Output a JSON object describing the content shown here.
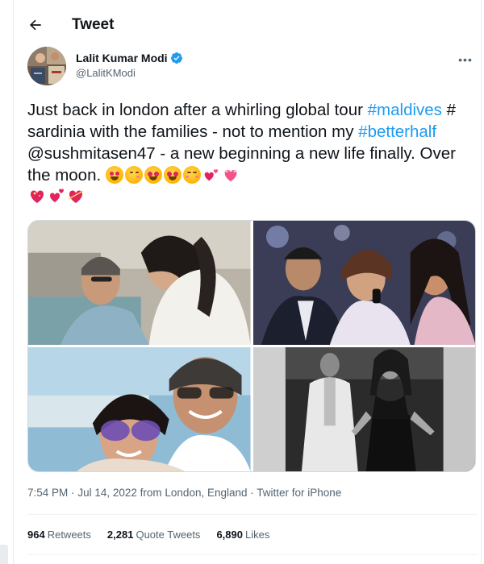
{
  "header": {
    "title": "Tweet"
  },
  "author": {
    "display_name": "Lalit Kumar Modi",
    "handle": "@LalitKModi",
    "verified": true
  },
  "tweet": {
    "segments": [
      {
        "text": "Just back in london after a whirling global tour ",
        "type": "text"
      },
      {
        "text": "#maldives",
        "type": "hashtag"
      },
      {
        "text": " # sardinia with the families - not to mention my ",
        "type": "text"
      },
      {
        "text": "#betterhalf",
        "type": "hashtag"
      },
      {
        "text": " @sushmitasen47 - a new beginning a new life finally. Over the moon. ",
        "type": "text"
      }
    ],
    "emojis": [
      "smiling-face-with-hearts",
      "face-blowing-kiss",
      "smiling-face-with-heart-eyes",
      "smiling-face-with-heart-eyes",
      "smiling-face-with-hearts",
      "two-hearts",
      "heart-with-ribbon",
      "sparkling-heart",
      "revolving-hearts",
      "heart-with-arrow"
    ]
  },
  "media": [
    {
      "name": "photo-couple-embrace",
      "tone": "color"
    },
    {
      "name": "photo-event-crowd",
      "tone": "color"
    },
    {
      "name": "photo-selfie-sunglasses",
      "tone": "color"
    },
    {
      "name": "photo-black-and-white",
      "tone": "grayscale"
    }
  ],
  "meta": {
    "time": "7:54 PM",
    "date": "Jul 14, 2022",
    "location_prefix": "from",
    "location": "London, England",
    "separator": "·",
    "source": "Twitter for iPhone"
  },
  "stats": {
    "retweets_count": "964",
    "retweets_label": "Retweets",
    "quotes_count": "2,281",
    "quotes_label": "Quote Tweets",
    "likes_count": "6,890",
    "likes_label": "Likes"
  },
  "colors": {
    "link": "#1d9bf0",
    "verified": "#1d9bf0",
    "secondary_text": "#536471"
  }
}
